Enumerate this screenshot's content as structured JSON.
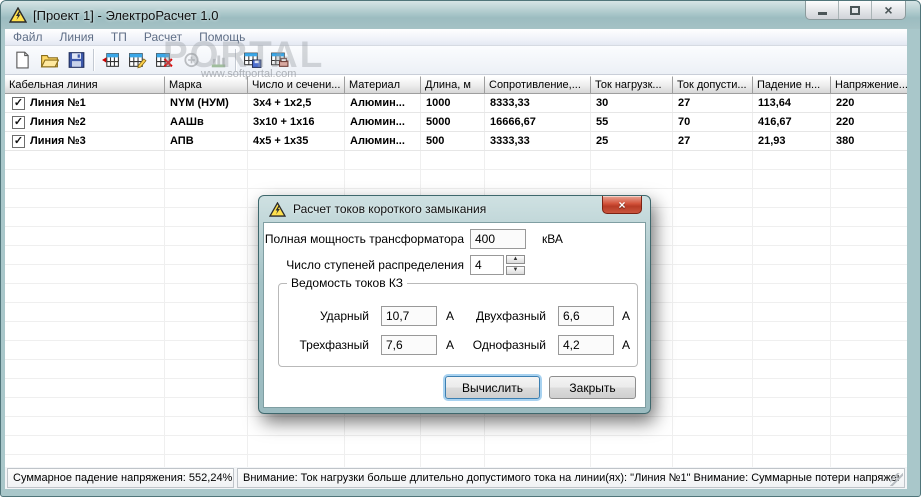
{
  "window": {
    "title": "[Проект 1] - ЭлектроРасчет 1.0",
    "icon": "warning-triangle-lightning",
    "controls": [
      "minimize",
      "maximize",
      "close"
    ]
  },
  "menu": {
    "items": [
      "Файл",
      "Линия",
      "ТП",
      "Расчет",
      "Помощь"
    ]
  },
  "toolbar": {
    "icons": [
      "new-document",
      "open-project",
      "save-project",
      "add-line",
      "edit-line",
      "delete-line",
      "calculate",
      "chart",
      "export-table",
      "print-table"
    ]
  },
  "watermark": {
    "big": "PORTAL",
    "small": "www.softportal.com"
  },
  "table": {
    "columns": [
      "Кабельная линия",
      "Марка",
      "Число и сечени...",
      "Материал",
      "Длина, м",
      "Сопротивление,...",
      "Ток нагрузк...",
      "Ток допусти...",
      "Падение н...",
      "Напряжение..."
    ],
    "rows": [
      {
        "checked": "✓",
        "cells": [
          "Линия №1",
          "NYM (НУМ)",
          "3x4 + 1x2,5",
          "Алюмин...",
          "1000",
          "8333,33",
          "30",
          "27",
          "113,64",
          "220"
        ]
      },
      {
        "checked": "✓",
        "cells": [
          "Линия №2",
          "ААШв",
          "3x10 + 1x16",
          "Алюмин...",
          "5000",
          "16666,67",
          "55",
          "70",
          "416,67",
          "220"
        ]
      },
      {
        "checked": "✓",
        "cells": [
          "Линия №3",
          "АПВ",
          "4x5 + 1x35",
          "Алюмин...",
          "500",
          "3333,33",
          "25",
          "27",
          "21,93",
          "380"
        ]
      }
    ]
  },
  "status": {
    "left": "Суммарное падение напряжения: 552,24%",
    "right": "Внимание: Ток нагрузки больше длительно допустимого тока на линии(ях): \"Линия №1\" Внимание: Суммарные потери напряжени"
  },
  "dialog": {
    "title": "Расчет токов короткого замыкания",
    "power": {
      "label": "Полная мощность трансформатора",
      "value": "400",
      "unit": "кВА"
    },
    "steps": {
      "label": "Число ступеней распределения",
      "value": "4"
    },
    "group": {
      "title": "Ведомость токов КЗ",
      "fields": [
        {
          "label": "Ударный",
          "value": "10,7",
          "unit": "А"
        },
        {
          "label": "Двухфазный",
          "value": "6,6",
          "unit": "А"
        },
        {
          "label": "Трехфазный",
          "value": "7,6",
          "unit": "А"
        },
        {
          "label": "Однофазный",
          "value": "4,2",
          "unit": "А"
        }
      ]
    },
    "buttons": {
      "calculate": "Вычислить",
      "close": "Закрыть"
    }
  }
}
